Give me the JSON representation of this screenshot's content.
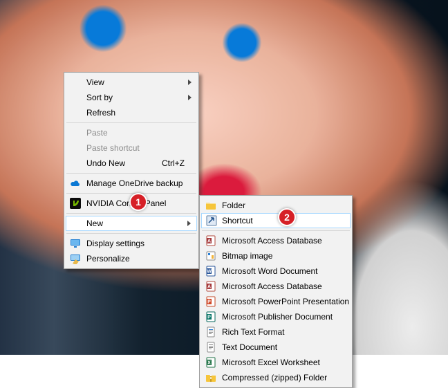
{
  "callouts": {
    "one": "1",
    "two": "2"
  },
  "primary_menu": {
    "view": {
      "label": "View"
    },
    "sortby": {
      "label": "Sort by"
    },
    "refresh": {
      "label": "Refresh"
    },
    "paste": {
      "label": "Paste"
    },
    "paste_shortcut": {
      "label": "Paste shortcut"
    },
    "undo": {
      "label": "Undo New",
      "keys": "Ctrl+Z"
    },
    "onedrive": {
      "label": "Manage OneDrive backup"
    },
    "nvidia": {
      "label": "NVIDIA Control Panel"
    },
    "new": {
      "label": "New"
    },
    "display": {
      "label": "Display settings"
    },
    "personalize": {
      "label": "Personalize"
    }
  },
  "submenu": {
    "folder": {
      "label": "Folder"
    },
    "shortcut": {
      "label": "Shortcut"
    },
    "access": {
      "label": "Microsoft Access Database"
    },
    "bitmap": {
      "label": "Bitmap image"
    },
    "word": {
      "label": "Microsoft Word Document"
    },
    "access2": {
      "label": "Microsoft Access Database"
    },
    "powerpoint": {
      "label": "Microsoft PowerPoint Presentation"
    },
    "publisher": {
      "label": "Microsoft Publisher Document"
    },
    "rtf": {
      "label": "Rich Text Format"
    },
    "txt": {
      "label": "Text Document"
    },
    "excel": {
      "label": "Microsoft Excel Worksheet"
    },
    "zip": {
      "label": "Compressed (zipped) Folder"
    }
  }
}
